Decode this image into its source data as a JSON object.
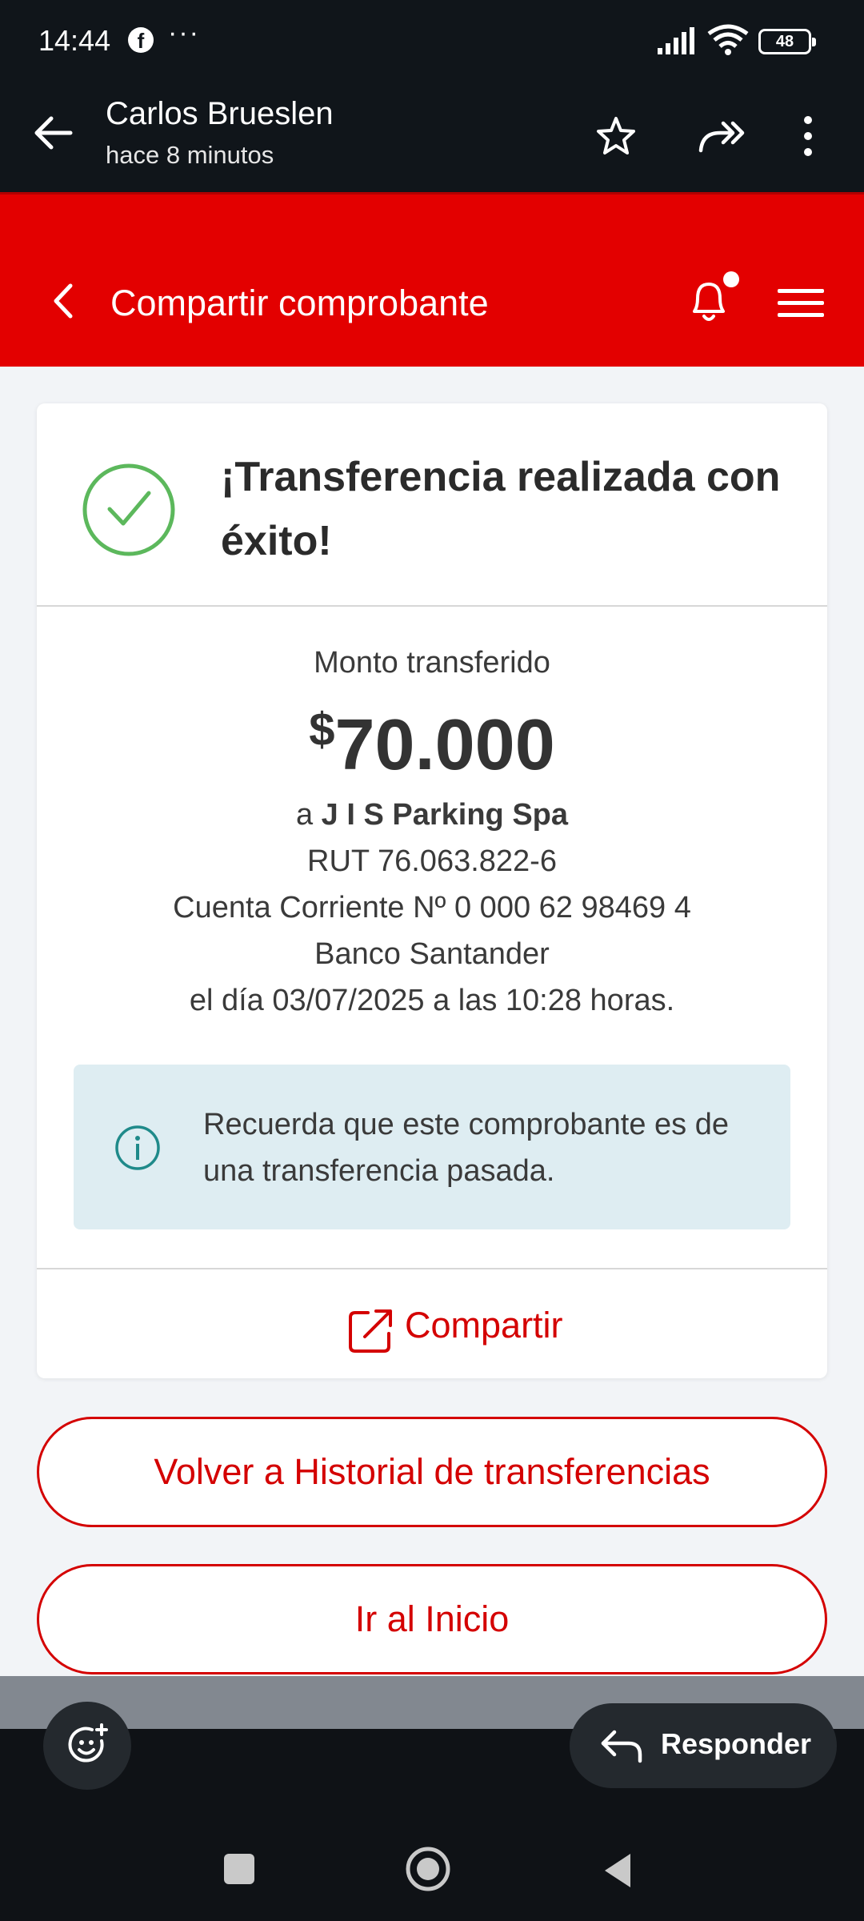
{
  "status_bar": {
    "time": "14:44",
    "dots": "···",
    "battery": "48",
    "facebook_glyph": "f"
  },
  "email_header": {
    "sender": "Carlos Brueslen",
    "sent_time": "hace 8 minutos"
  },
  "app": {
    "title": "Compartir comprobante",
    "brand_color": "#e30000"
  },
  "receipt": {
    "success_title": "¡Transferencia realizada con éxito!",
    "amount_label": "Monto transferido",
    "currency": "$",
    "amount": "70.000",
    "to_prefix": "a",
    "recipient": "J I S Parking Spa",
    "rut": "RUT 76.063.822-6",
    "account": "Cuenta Corriente Nº 0 000 62 98469 4",
    "bank": "Banco Santander",
    "datetime": "el día 03/07/2025 a las 10:28 horas.",
    "info_note": "Recuerda que este comprobante es de una transferencia pasada.",
    "share_label": "Compartir"
  },
  "buttons": {
    "history": "Volver a Historial de transferencias",
    "home": "Ir al Inicio"
  },
  "reply": {
    "label": "Responder"
  },
  "colors": {
    "success_green": "#5cb85c",
    "info_teal": "#1f8a8a",
    "action_red": "#d40000"
  }
}
